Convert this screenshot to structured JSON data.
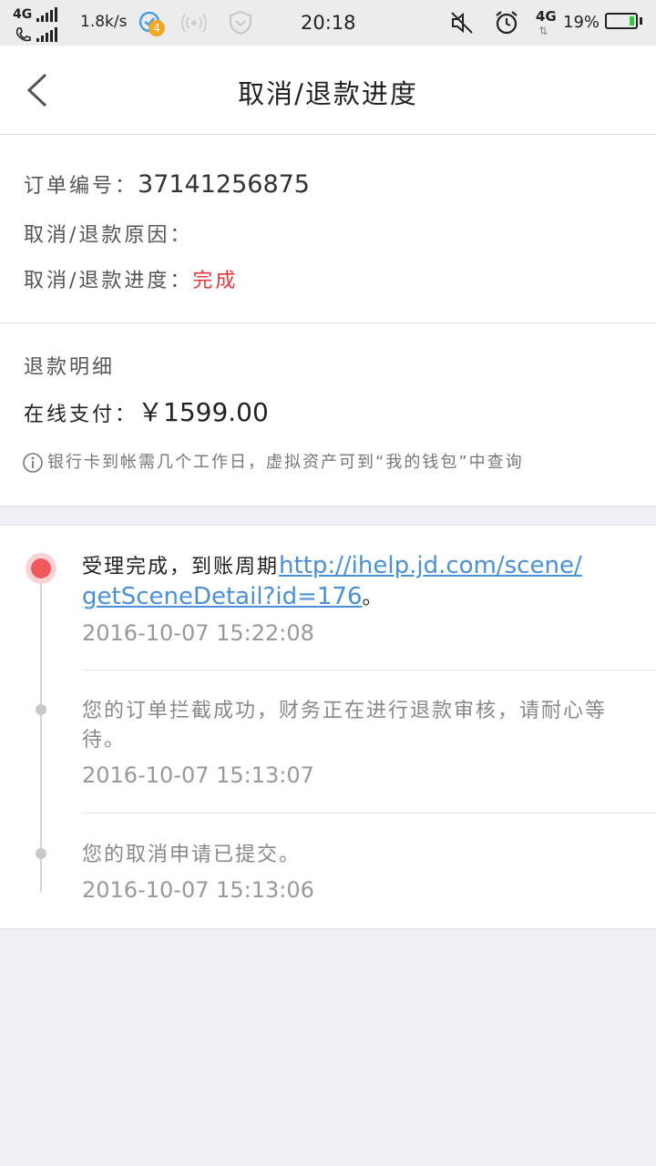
{
  "status_bar": {
    "network_top": "4G",
    "speed": "1.8k/s",
    "notification_count": "4",
    "time": "20:18",
    "network_right": "4G",
    "battery_percent": "19%",
    "battery_level": 0.19,
    "battery_color": "#2ecc40"
  },
  "header": {
    "title": "取消/退款进度"
  },
  "order": {
    "number_label": "订单编号：",
    "number": "37141256875",
    "reason_label": "取消/退款原因：",
    "reason": "",
    "progress_label": "取消/退款进度：",
    "progress": "完成"
  },
  "refund": {
    "title": "退款明细",
    "pay_label": "在线支付：",
    "amount": "￥1599.00",
    "notice": "银行卡到帐需几个工作日，虚拟资产可到“我的钱包”中查询"
  },
  "timeline": {
    "items": [
      {
        "text": "受理完成，到账周期",
        "link": "http://ihelp.jd.com/scene/getSceneDetail?id=176",
        "link_line1": "http://ihelp.jd.com/scene/",
        "link_line2": "getSceneDetail?id=176",
        "suffix": "。",
        "time": "2016-10-07 15:22:08"
      },
      {
        "text": "您的订单拦截成功，财务正在进行退款审核，请耐心等待。",
        "time": "2016-10-07 15:13:07"
      },
      {
        "text": "您的取消申请已提交。",
        "time": "2016-10-07 15:13:06"
      }
    ]
  },
  "colors": {
    "accent_red": "#e4393c",
    "link_blue": "#4a90d9",
    "active_dot": "#f15a5c"
  }
}
